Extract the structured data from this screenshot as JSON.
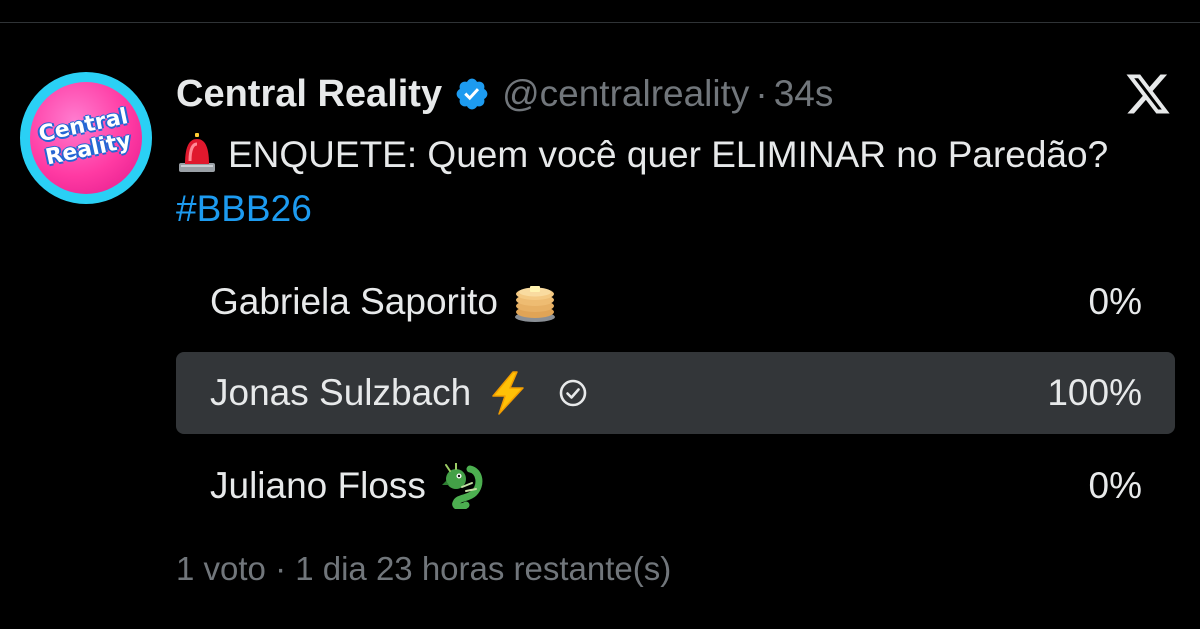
{
  "tweet": {
    "author_name": "Central Reality",
    "handle": "@centralreality",
    "separator": "·",
    "time": "34s",
    "text_main": "ENQUETE: Quem você quer ELIMINAR no Paredão?",
    "hashtag": "#BBB26"
  },
  "avatar": {
    "line1": "Central",
    "line2": "Reality"
  },
  "icons": {
    "verified": "verified-badge-icon",
    "platform": "x-logo-icon",
    "siren": "siren-emoji",
    "selected": "check-circle-icon"
  },
  "poll": {
    "options": [
      {
        "label": "Gabriela Saporito",
        "emoji": "pancakes",
        "percent_text": "0%",
        "percent": 0,
        "selected": false
      },
      {
        "label": "Jonas Sulzbach",
        "emoji": "high-voltage",
        "percent_text": "100%",
        "percent": 100,
        "selected": true
      },
      {
        "label": "Juliano Floss",
        "emoji": "dragon",
        "percent_text": "0%",
        "percent": 0,
        "selected": false
      }
    ],
    "footer": "1 voto · 1 dia 23 horas restante(s)"
  },
  "colors": {
    "background": "#000000",
    "text": "#e7e9ea",
    "muted": "#71767b",
    "link": "#1d9bf0",
    "verified": "#1d9bf0",
    "selected_bar": "#333639"
  }
}
